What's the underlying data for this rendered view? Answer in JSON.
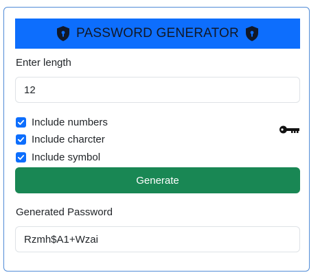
{
  "header": {
    "title": "PASSWORD GENERATOR",
    "left_icon": "shield-lock-icon",
    "right_icon": "shield-lock-icon"
  },
  "length": {
    "label": "Enter length",
    "value": "12"
  },
  "options": [
    {
      "label": "Include numbers",
      "checked": true
    },
    {
      "label": "Include charcter",
      "checked": true
    },
    {
      "label": "Include symbol",
      "checked": true
    }
  ],
  "key_icon": "key-icon",
  "generate_button": {
    "label": "Generate"
  },
  "output": {
    "label": "Generated Password",
    "value": "Rzmh$A1+Wzai"
  },
  "colors": {
    "header_bg": "#0d6efd",
    "button_bg": "#198754",
    "checkbox": "#0d6efd",
    "card_border": "#4f8ad6"
  }
}
